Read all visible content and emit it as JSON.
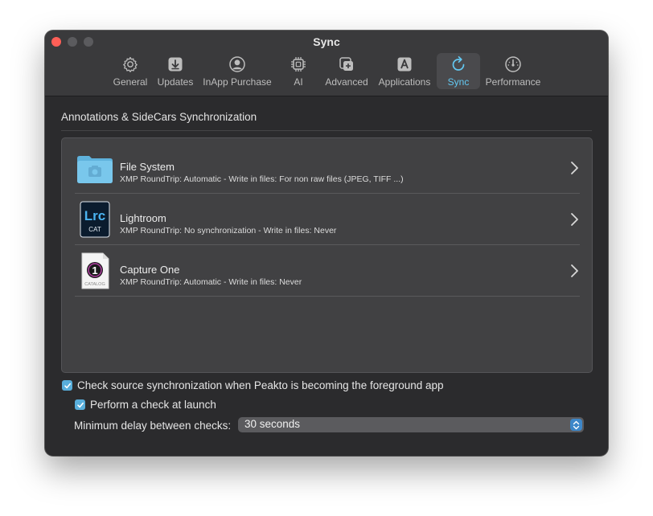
{
  "window": {
    "title": "Sync"
  },
  "toolbar": {
    "tabs": [
      {
        "label": "General",
        "icon": "gear-icon"
      },
      {
        "label": "Updates",
        "icon": "download-icon"
      },
      {
        "label": "InApp Purchase",
        "icon": "person-circle-icon"
      },
      {
        "label": "AI",
        "icon": "cpu-chip-icon"
      },
      {
        "label": "Advanced",
        "icon": "advanced-icon"
      },
      {
        "label": "Applications",
        "icon": "app-a-icon"
      },
      {
        "label": "Sync",
        "icon": "sync-arrow-icon",
        "active": true
      },
      {
        "label": "Performance",
        "icon": "gauge-icon"
      }
    ]
  },
  "section": {
    "title": "Annotations & SideCars Synchronization"
  },
  "sources": [
    {
      "name": "File System",
      "description": "XMP RoundTrip: Automatic - Write in files: For non raw files (JPEG, TIFF ...)",
      "icon": "folder-icon"
    },
    {
      "name": "Lightroom",
      "description": "XMP RoundTrip: No synchronization - Write in files: Never",
      "icon": "lightroom-catalog-icon",
      "icon_text": "Lrc",
      "icon_subtext": "CAT"
    },
    {
      "name": "Capture One",
      "description": "XMP RoundTrip: Automatic - Write in files: Never",
      "icon": "capture-one-catalog-icon",
      "icon_text": "1",
      "icon_subtext": "CATALOG"
    }
  ],
  "options": {
    "check_foreground_label": "Check source synchronization when Peakto is becoming the foreground app",
    "check_foreground_checked": true,
    "check_launch_label": "Perform a check at launch",
    "check_launch_checked": true,
    "delay_label": "Minimum delay between checks:",
    "delay_value": "30 seconds"
  },
  "colors": {
    "accent": "#63c8f2",
    "checkbox": "#58aedb",
    "window_bg": "#2b2b2d",
    "close": "#ff5f57"
  }
}
